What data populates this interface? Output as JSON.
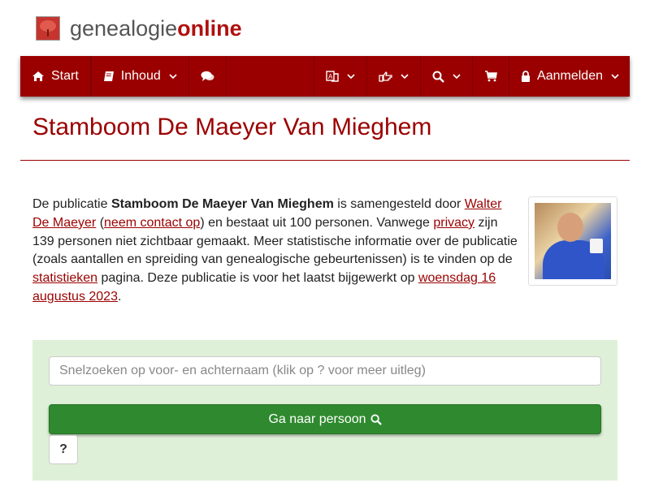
{
  "brand": {
    "part1": "genealogie",
    "part2": "online"
  },
  "nav": {
    "start": "Start",
    "inhoud": "Inhoud",
    "aanmelden": "Aanmelden"
  },
  "icons": {
    "logo": "tree-icon",
    "start": "home-icon",
    "inhoud": "book-icon",
    "chat": "comments-icon",
    "language": "translate-icon",
    "share": "pointing-hand-icon",
    "search": "search-icon",
    "cart": "shopping-cart-icon",
    "lock": "lock-icon"
  },
  "colors": {
    "brand": "#9b0000",
    "panel": "#dff0d8",
    "button": "#2f8a2f"
  },
  "page": {
    "title": "Stamboom De Maeyer Van Mieghem"
  },
  "intro": {
    "t1": "De publicatie ",
    "pub_name": "Stamboom De Maeyer Van Mieghem",
    "t2": " is samengesteld door ",
    "author": "Walter De Maeyer",
    "t3": " (",
    "contact": "neem contact op",
    "t4": ") en bestaat uit 100 personen. Vanwege ",
    "privacy": "privacy",
    "t5": " zijn 139 personen niet zichtbaar gemaakt. Meer statistische informatie over de publicatie (zoals aantallen en spreiding van genealogische gebeurtenissen) is te vinden op de ",
    "stats": "statistieken",
    "t6": " pagina. Deze publicatie is voor het laatst bijgewerkt op ",
    "date": "woensdag 16 augustus 2023",
    "t7": "."
  },
  "search": {
    "placeholder": "Snelzoeken op voor- en achternaam (klik op ? voor meer uitleg)",
    "go_label": "Ga naar persoon",
    "help_label": "?"
  }
}
